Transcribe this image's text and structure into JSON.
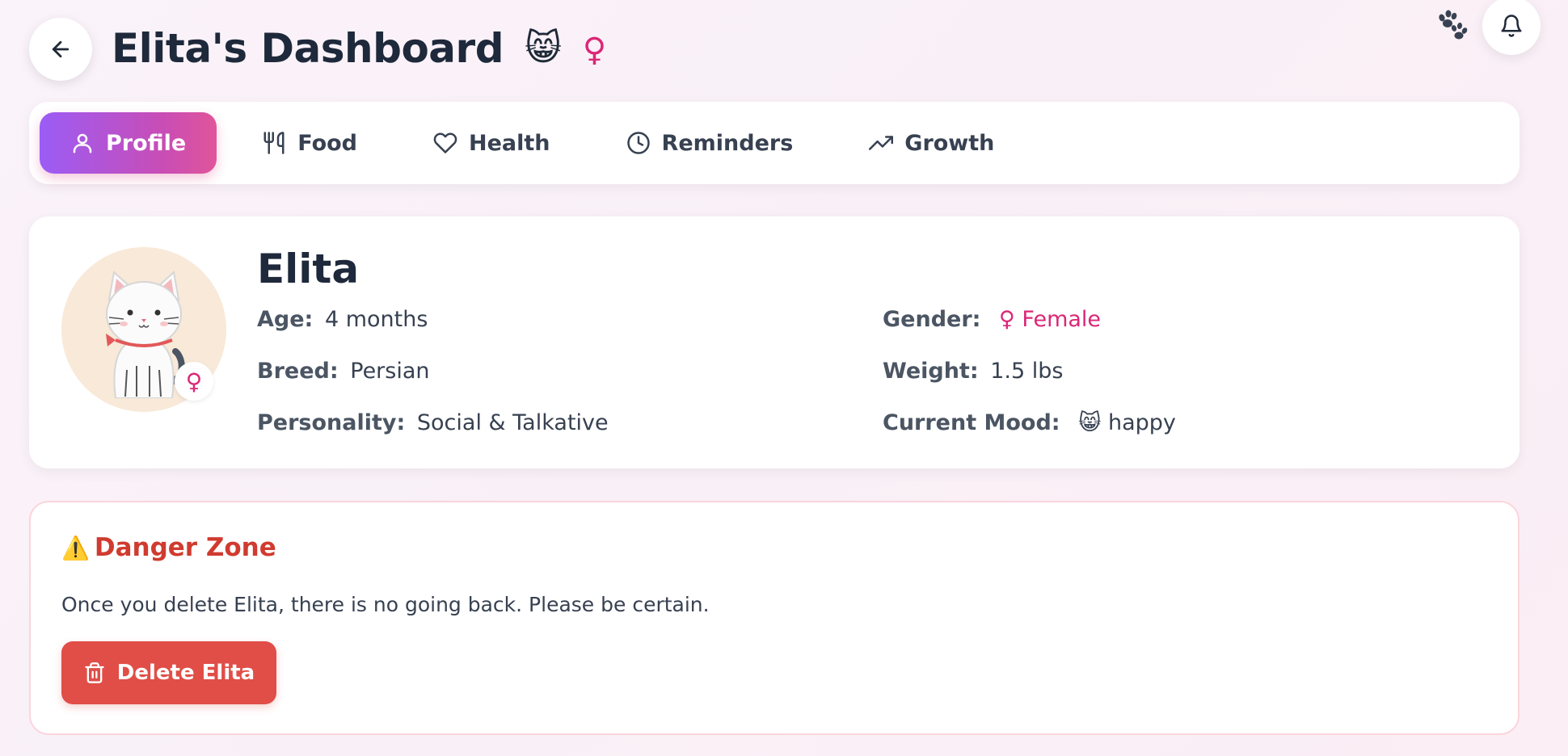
{
  "header": {
    "title": "Elita's Dashboard",
    "title_emoji": "😸",
    "gender_symbol": "♀"
  },
  "tabs": [
    {
      "label": "Profile",
      "icon": "user-icon",
      "active": true
    },
    {
      "label": "Food",
      "icon": "utensils-icon",
      "active": false
    },
    {
      "label": "Health",
      "icon": "heart-icon",
      "active": false
    },
    {
      "label": "Reminders",
      "icon": "clock-icon",
      "active": false
    },
    {
      "label": "Growth",
      "icon": "trending-up-icon",
      "active": false
    }
  ],
  "profile": {
    "name": "Elita",
    "avatar_badge": "♀",
    "age_label": "Age:",
    "age_value": "4 months",
    "breed_label": "Breed:",
    "breed_value": "Persian",
    "personality_label": "Personality:",
    "personality_value": "Social & Talkative",
    "gender_label": "Gender:",
    "gender_symbol": "♀",
    "gender_value": "Female",
    "weight_label": "Weight:",
    "weight_value": "1.5 lbs",
    "mood_label": "Current Mood:",
    "mood_emoji": "😸",
    "mood_value": "happy"
  },
  "danger": {
    "icon": "⚠️",
    "title": "Danger Zone",
    "description": "Once you delete Elita, there is no going back. Please be certain.",
    "button_label": "Delete Elita"
  },
  "colors": {
    "accent_pink": "#db2777",
    "tab_gradient_start": "#9b5cf6",
    "tab_gradient_end": "#e0559a",
    "danger_red": "#e04e47"
  }
}
